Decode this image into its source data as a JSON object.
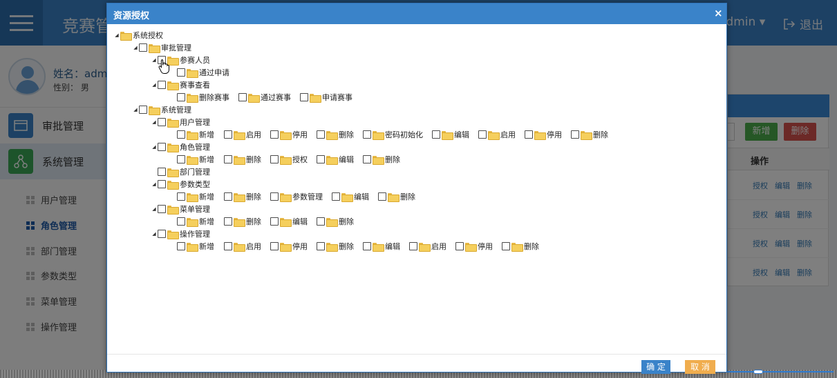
{
  "app": {
    "brand": "竞赛管",
    "user": "admin",
    "logout": "退出",
    "profile": {
      "name": "姓名：admi",
      "gender": "性别：  男"
    },
    "nav": {
      "approve": "审批管理",
      "system": "系统管理"
    },
    "sub_items": [
      "用户管理",
      "角色管理",
      "部门管理",
      "参数类型",
      "菜单管理",
      "操作管理"
    ],
    "active_sub": "角色管理",
    "toolbar": {
      "add": "新增",
      "delete": "删除"
    },
    "table": {
      "op_header": "操作",
      "row_actions": [
        "授权",
        "编辑",
        "删除"
      ]
    }
  },
  "dialog": {
    "title": "资源授权",
    "close": "×",
    "ok": "确 定",
    "cancel": "取 消"
  },
  "tree": {
    "root": "系统授权",
    "approve": "审批管理",
    "participants": "参赛人员",
    "pass_apply": "通过申请",
    "event_view": "赛事查看",
    "event_view_children": [
      "删除赛事",
      "通过赛事",
      "申请赛事"
    ],
    "system": "系统管理",
    "user_mgmt": "用户管理",
    "user_mgmt_children": [
      "新增",
      "启用",
      "停用",
      "删除",
      "密码初始化",
      "编辑",
      "启用",
      "停用",
      "删除"
    ],
    "role_mgmt": "角色管理",
    "role_mgmt_children": [
      "新增",
      "删除",
      "授权",
      "编辑",
      "删除"
    ],
    "dept_mgmt": "部门管理",
    "param_type": "参数类型",
    "param_type_children": [
      "新增",
      "删除",
      "参数管理",
      "编辑",
      "删除"
    ],
    "menu_mgmt": "菜单管理",
    "menu_mgmt_children": [
      "新增",
      "删除",
      "编辑",
      "删除"
    ],
    "op_mgmt": "操作管理",
    "op_mgmt_children": [
      "新增",
      "启用",
      "停用",
      "删除",
      "编辑",
      "启用",
      "停用",
      "删除"
    ]
  }
}
